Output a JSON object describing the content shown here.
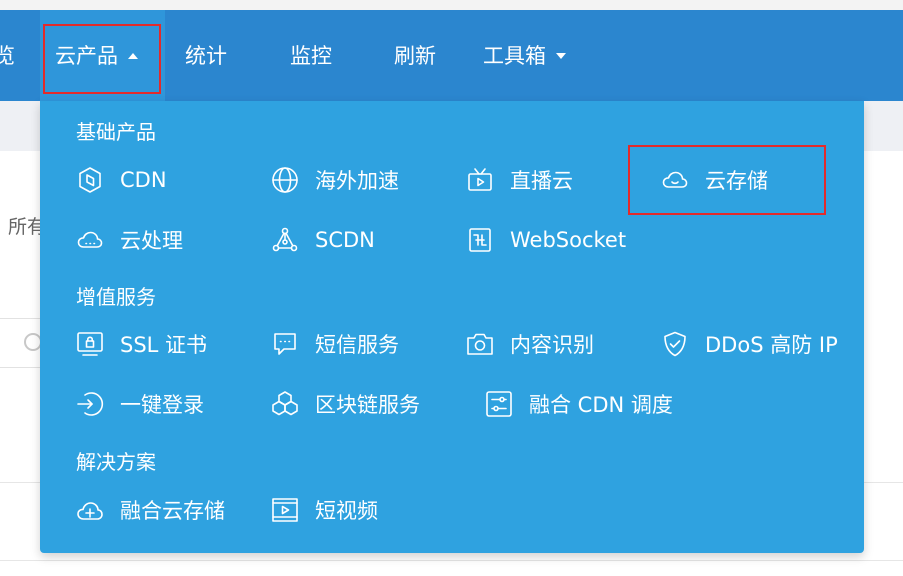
{
  "nav": {
    "left_fragment": "览",
    "items": [
      {
        "label": "云产品"
      },
      {
        "label": "统计"
      },
      {
        "label": "监控"
      },
      {
        "label": "刷新"
      },
      {
        "label": "工具箱"
      }
    ]
  },
  "page": {
    "left_text_fragment": "所有"
  },
  "dropdown": {
    "sections": [
      {
        "title": "基础产品",
        "items": [
          {
            "label": "CDN",
            "icon": "cdn-shield-icon"
          },
          {
            "label": "海外加速",
            "icon": "globe-icon"
          },
          {
            "label": "直播云",
            "icon": "tv-play-icon"
          },
          {
            "label": "云存储",
            "icon": "cloud-icon"
          },
          {
            "label": "云处理",
            "icon": "cloud-process-icon"
          },
          {
            "label": "SCDN",
            "icon": "network-nodes-icon"
          },
          {
            "label": "WebSocket",
            "icon": "websocket-icon"
          }
        ]
      },
      {
        "title": "增值服务",
        "items": [
          {
            "label": "SSL 证书",
            "icon": "monitor-lock-icon"
          },
          {
            "label": "短信服务",
            "icon": "chat-bubble-icon"
          },
          {
            "label": "内容识别",
            "icon": "camera-icon"
          },
          {
            "label": "DDoS 高防 IP",
            "icon": "shield-check-icon"
          },
          {
            "label": "一键登录",
            "icon": "login-arrow-icon"
          },
          {
            "label": "区块链服务",
            "icon": "blockchain-cubes-icon"
          },
          {
            "label": "融合 CDN 调度",
            "icon": "sliders-icon"
          }
        ]
      },
      {
        "title": "解决方案",
        "items": [
          {
            "label": "融合云存储",
            "icon": "cloud-plus-icon"
          },
          {
            "label": "短视频",
            "icon": "video-frame-icon"
          }
        ]
      }
    ]
  },
  "colors": {
    "navbar": "#2b86cf",
    "dropdown": "#2fa2e0",
    "highlight_border": "#e32b2b",
    "text": "#ffffff"
  }
}
